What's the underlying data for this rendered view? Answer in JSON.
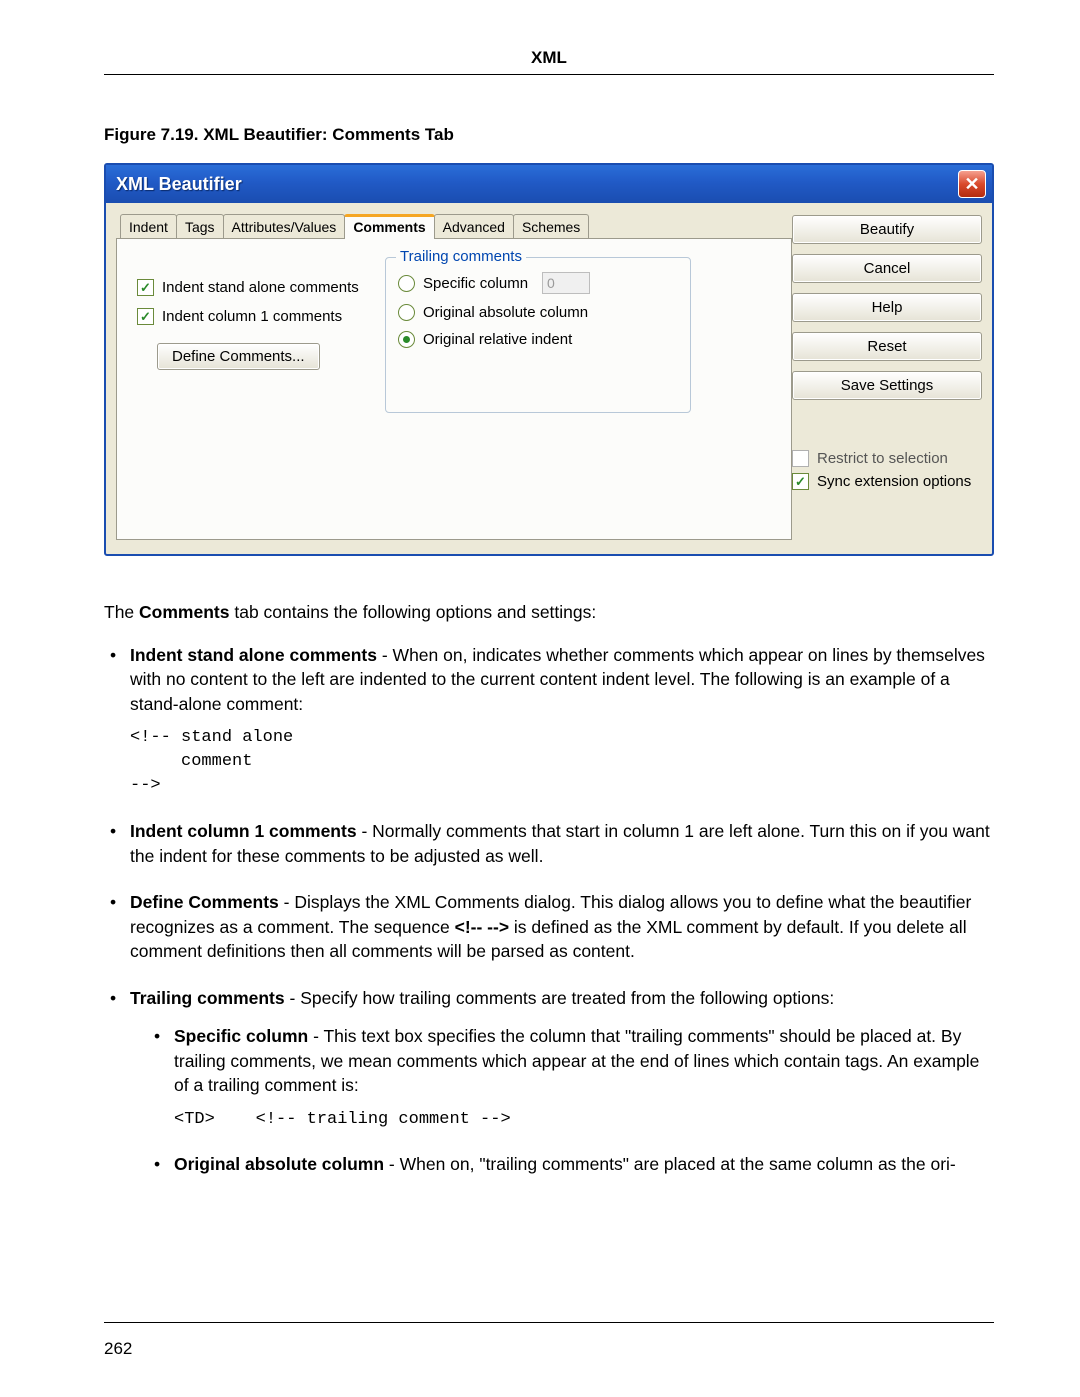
{
  "header": {
    "title": "XML"
  },
  "figure": {
    "caption": "Figure 7.19. XML Beautifier: Comments Tab"
  },
  "dialog": {
    "title": "XML Beautifier",
    "close_glyph": "✕",
    "tabs": [
      "Indent",
      "Tags",
      "Attributes/Values",
      "Comments",
      "Advanced",
      "Schemes"
    ],
    "left_checks": [
      "Indent stand alone comments",
      "Indent column 1 comments"
    ],
    "define_comments_btn": "Define Comments...",
    "trailing": {
      "legend": "Trailing comments",
      "options": [
        "Specific column",
        "Original absolute column",
        "Original relative indent"
      ],
      "specific_value": "0",
      "selected": "Original relative indent"
    },
    "side_buttons": [
      "Beautify",
      "Cancel",
      "Help",
      "Reset",
      "Save Settings"
    ],
    "side_checks": [
      "Restrict to selection",
      "Sync extension options"
    ]
  },
  "body": {
    "intro": [
      "The",
      "Comments",
      "tab contains the following options and settings:"
    ],
    "items": [
      {
        "term": "Indent stand alone comments",
        "text": "- When on, indicates whether comments which appear on lines by themselves with no content to the left are indented to the current content indent level. The following is an example of a stand-alone comment:",
        "code": "<!-- stand alone\n     comment\n-->"
      },
      {
        "term": "Indent column 1 comments",
        "text": "- Normally comments that start in column 1 are left alone. Turn this on if you want the indent for these comments to be adjusted as well."
      },
      {
        "term": "Define Comments",
        "text_a": "- Displays the XML Comments dialog. This dialog allows you to define what the beautifier recognizes as a comment. The sequence",
        "seq": "<!-- -->",
        "text_b": "is defined as the XML comment by default. If you delete all comment definitions then all comments will be parsed as content."
      },
      {
        "term": "Trailing comments",
        "text": "- Specify how trailing comments are treated from the following options:",
        "sub": [
          {
            "term": "Specific column",
            "text": "- This text box specifies the column that \"trailing comments\" should be placed at. By trailing comments, we mean comments which appear at the end of lines which contain tags. An example of a trailing comment is:",
            "code": "<TD>    <!-- trailing comment -->"
          },
          {
            "term": "Original absolute column",
            "text": "- When on, \"trailing comments\" are placed at the same column as the ori-"
          }
        ]
      }
    ]
  },
  "footer": {
    "page": "262"
  }
}
